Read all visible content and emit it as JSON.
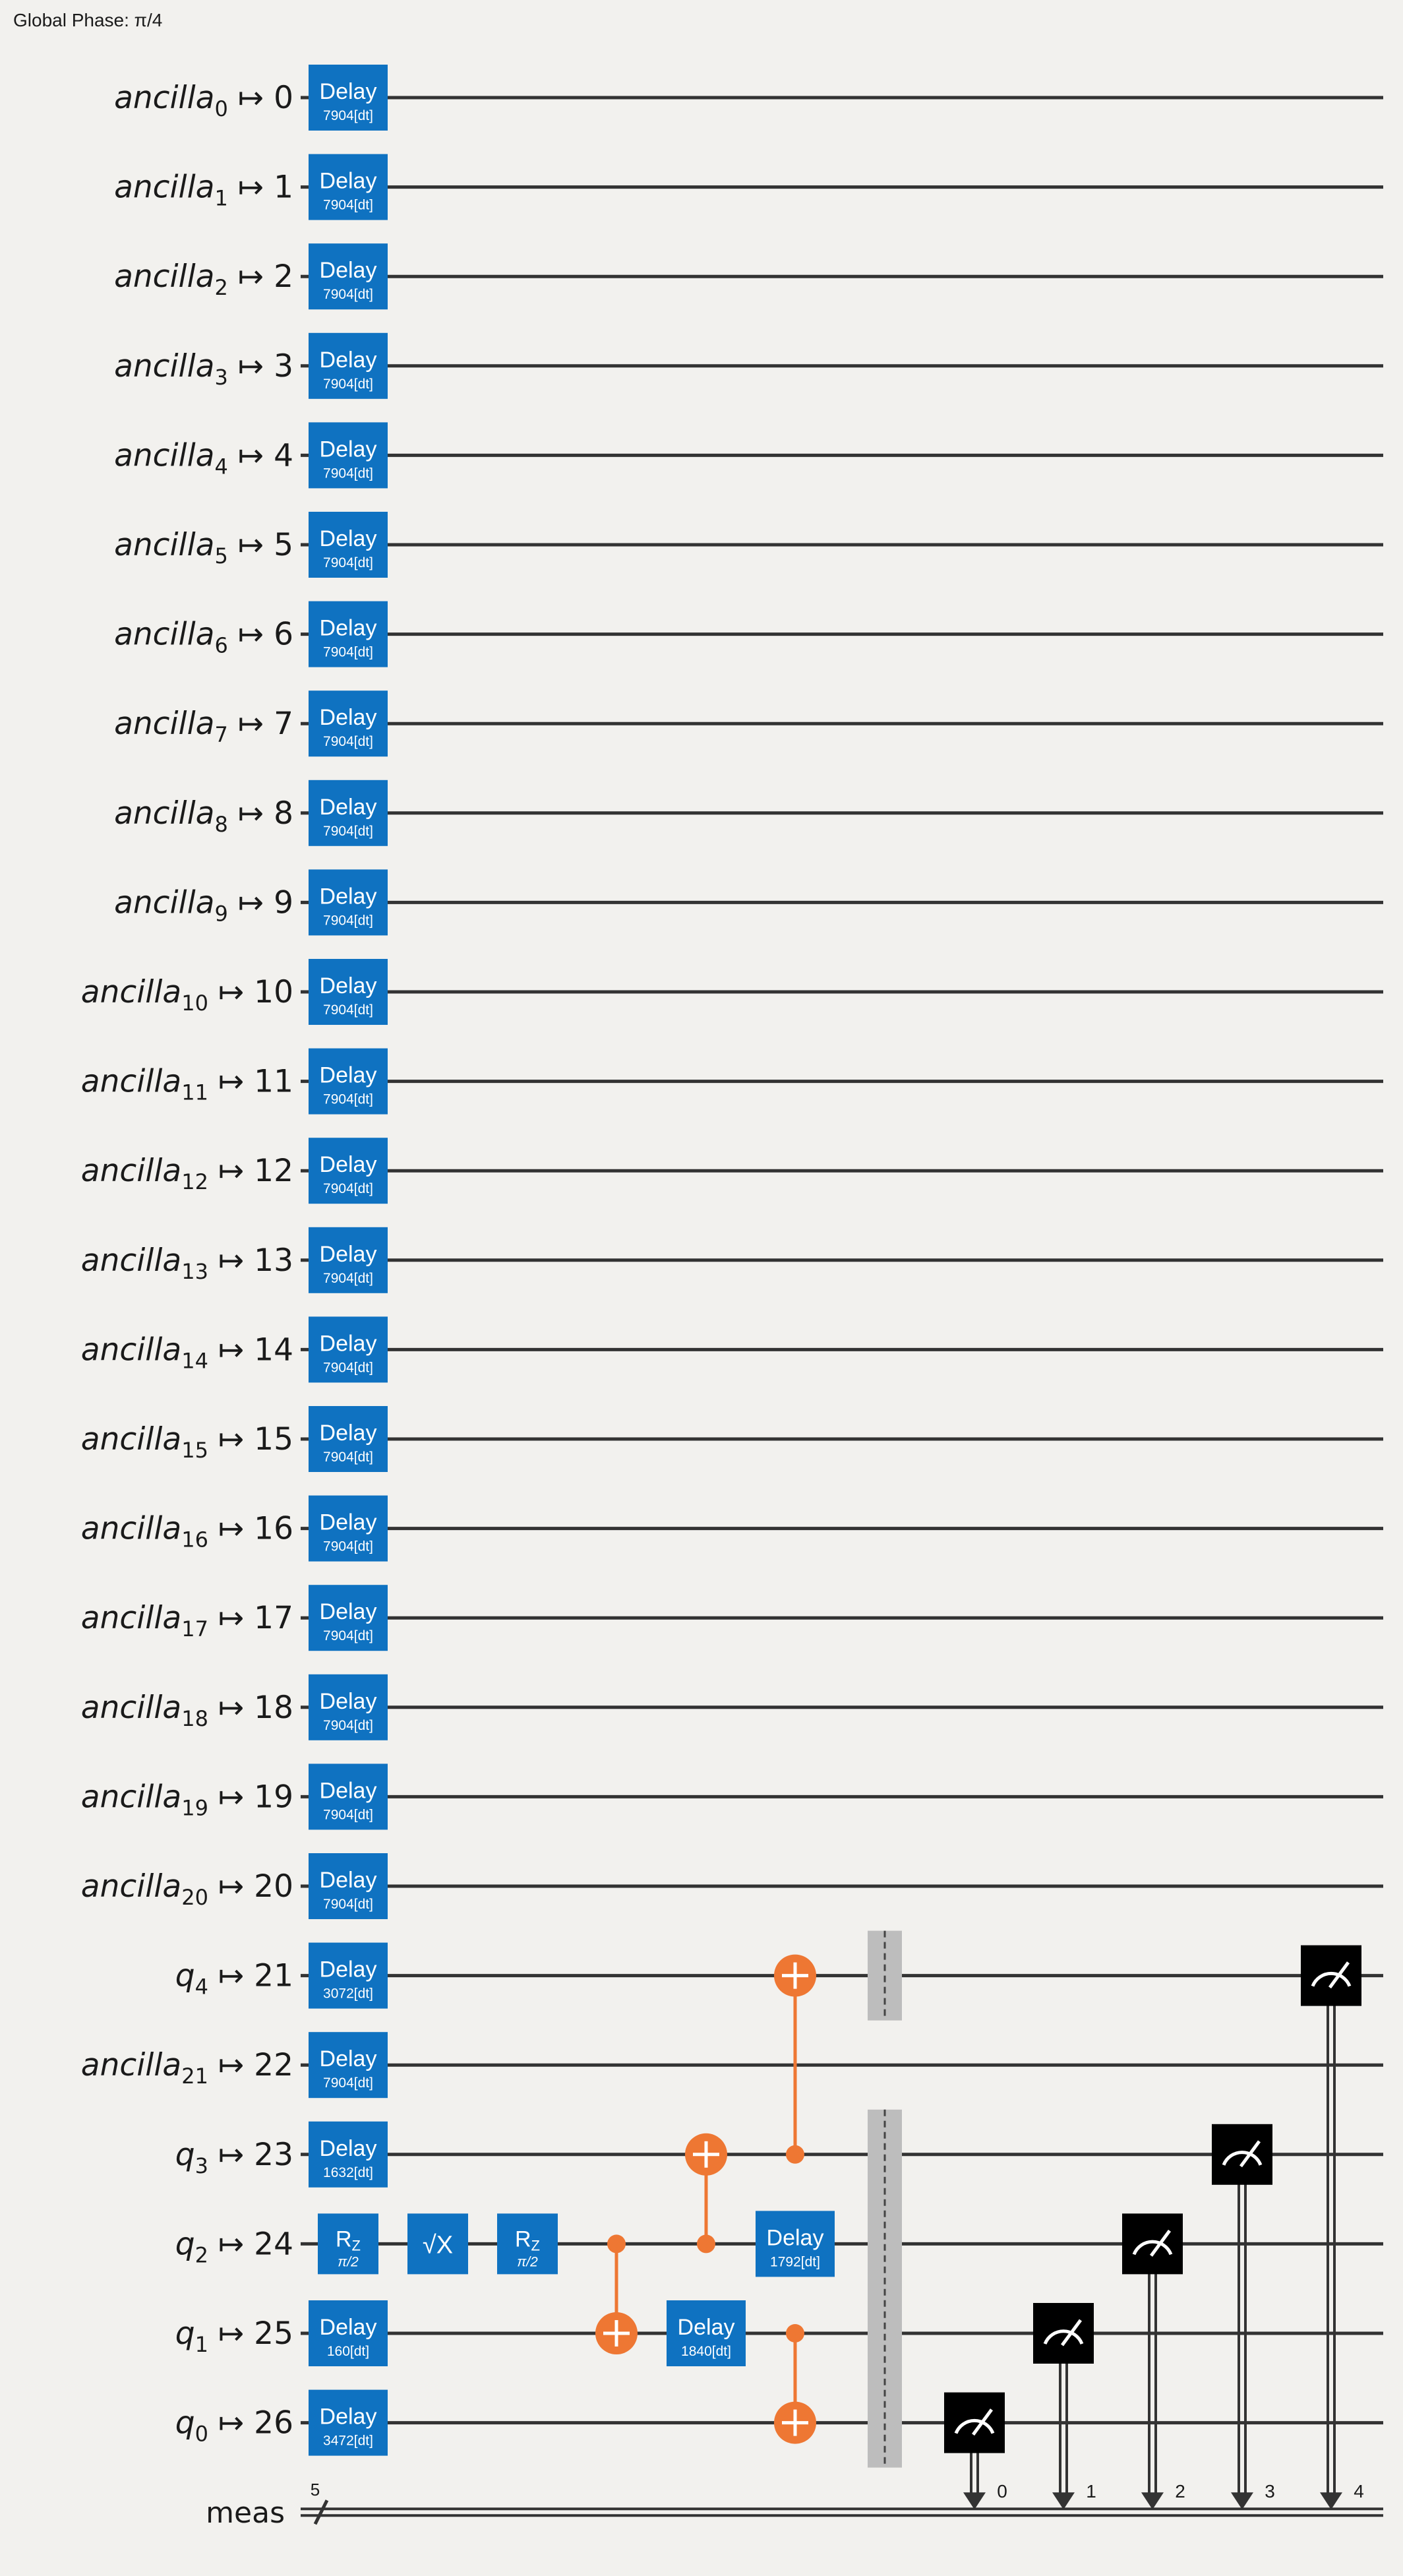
{
  "global_phase": "Global Phase: π/4",
  "colors": {
    "background": "#f2f1ee",
    "wire": "#333333",
    "gate_blue": "#0f72c1",
    "cx_orange": "#ee7733",
    "measure_black": "#000000",
    "barrier_gray": "#bdbdbd",
    "text_white": "#ffffff",
    "text_dark": "#1a1a1a"
  },
  "qubits": [
    {
      "name": "ancilla",
      "sub": "0",
      "phys": "0",
      "delay": "7904[dt]"
    },
    {
      "name": "ancilla",
      "sub": "1",
      "phys": "1",
      "delay": "7904[dt]"
    },
    {
      "name": "ancilla",
      "sub": "2",
      "phys": "2",
      "delay": "7904[dt]"
    },
    {
      "name": "ancilla",
      "sub": "3",
      "phys": "3",
      "delay": "7904[dt]"
    },
    {
      "name": "ancilla",
      "sub": "4",
      "phys": "4",
      "delay": "7904[dt]"
    },
    {
      "name": "ancilla",
      "sub": "5",
      "phys": "5",
      "delay": "7904[dt]"
    },
    {
      "name": "ancilla",
      "sub": "6",
      "phys": "6",
      "delay": "7904[dt]"
    },
    {
      "name": "ancilla",
      "sub": "7",
      "phys": "7",
      "delay": "7904[dt]"
    },
    {
      "name": "ancilla",
      "sub": "8",
      "phys": "8",
      "delay": "7904[dt]"
    },
    {
      "name": "ancilla",
      "sub": "9",
      "phys": "9",
      "delay": "7904[dt]"
    },
    {
      "name": "ancilla",
      "sub": "10",
      "phys": "10",
      "delay": "7904[dt]"
    },
    {
      "name": "ancilla",
      "sub": "11",
      "phys": "11",
      "delay": "7904[dt]"
    },
    {
      "name": "ancilla",
      "sub": "12",
      "phys": "12",
      "delay": "7904[dt]"
    },
    {
      "name": "ancilla",
      "sub": "13",
      "phys": "13",
      "delay": "7904[dt]"
    },
    {
      "name": "ancilla",
      "sub": "14",
      "phys": "14",
      "delay": "7904[dt]"
    },
    {
      "name": "ancilla",
      "sub": "15",
      "phys": "15",
      "delay": "7904[dt]"
    },
    {
      "name": "ancilla",
      "sub": "16",
      "phys": "16",
      "delay": "7904[dt]"
    },
    {
      "name": "ancilla",
      "sub": "17",
      "phys": "17",
      "delay": "7904[dt]"
    },
    {
      "name": "ancilla",
      "sub": "18",
      "phys": "18",
      "delay": "7904[dt]"
    },
    {
      "name": "ancilla",
      "sub": "19",
      "phys": "19",
      "delay": "7904[dt]"
    },
    {
      "name": "ancilla",
      "sub": "20",
      "phys": "20",
      "delay": "7904[dt]"
    },
    {
      "name": "q",
      "sub": "4",
      "phys": "21",
      "delay": "3072[dt]"
    },
    {
      "name": "ancilla",
      "sub": "21",
      "phys": "22",
      "delay": "7904[dt]"
    },
    {
      "name": "q",
      "sub": "3",
      "phys": "23",
      "delay": "1632[dt]"
    },
    {
      "name": "q",
      "sub": "2",
      "phys": "24",
      "delay": null
    },
    {
      "name": "q",
      "sub": "1",
      "phys": "25",
      "delay": "160[dt]"
    },
    {
      "name": "q",
      "sub": "0",
      "phys": "26",
      "delay": "3472[dt]"
    }
  ],
  "mapsto": "↦",
  "classical": {
    "name": "meas",
    "width": "5"
  },
  "gate_label_delay": "Delay",
  "q2_ops": [
    {
      "type": "rz",
      "label": "R",
      "sub": "Z",
      "param": "π/2",
      "col": 0
    },
    {
      "type": "sx",
      "label": "√X",
      "col": 1
    },
    {
      "type": "rz",
      "label": "R",
      "sub": "Z",
      "param": "π/2",
      "col": 2
    }
  ],
  "cx_gates": [
    {
      "control": 24,
      "target": 25,
      "col": 3
    },
    {
      "control": 24,
      "target": 23,
      "col": 4
    },
    {
      "control": 23,
      "target": 21,
      "col": 5
    },
    {
      "control": 25,
      "target": 26,
      "col": 5
    }
  ],
  "mid_delays": [
    {
      "row": 25,
      "value": "1840[dt]",
      "col": 4
    },
    {
      "row": 24,
      "value": "1792[dt]",
      "col": 5
    }
  ],
  "barriers": [
    {
      "rows": [
        21
      ]
    },
    {
      "rows": [
        23,
        24,
        25,
        26
      ]
    }
  ],
  "measurements": [
    {
      "row": 26,
      "bit": "0",
      "col": 7
    },
    {
      "row": 25,
      "bit": "1",
      "col": 8
    },
    {
      "row": 24,
      "bit": "2",
      "col": 9
    },
    {
      "row": 23,
      "bit": "3",
      "col": 10
    },
    {
      "row": 21,
      "bit": "4",
      "col": 11
    }
  ]
}
